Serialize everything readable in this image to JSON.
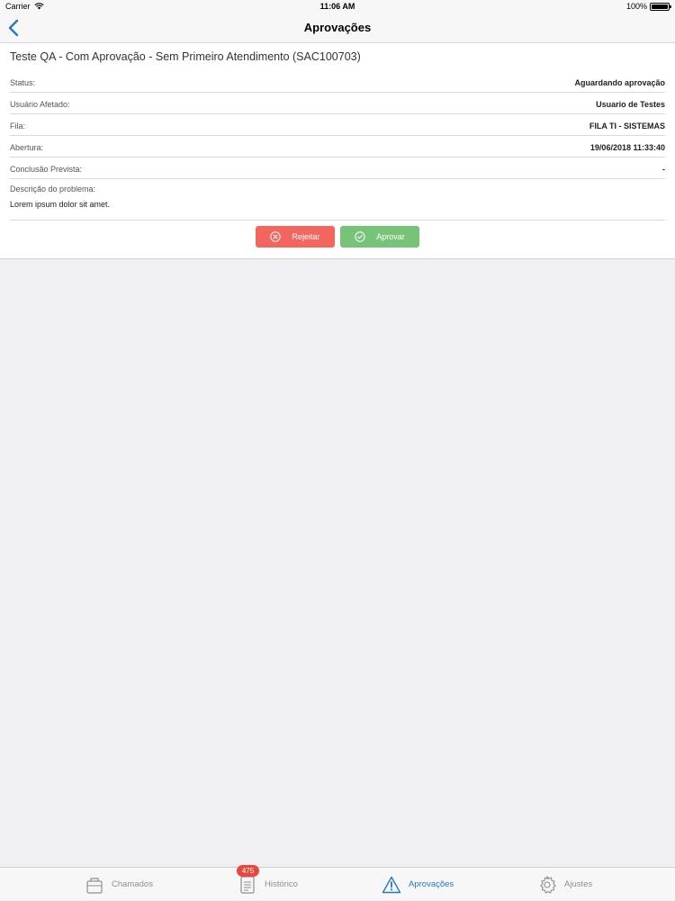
{
  "status_bar": {
    "carrier": "Carrier",
    "time": "11:06 AM",
    "battery": "100%",
    "battery_level": 1.0
  },
  "nav": {
    "title": "Aprovações",
    "back_icon": "chevron-left-icon"
  },
  "ticket": {
    "heading": "Teste QA - Com Aprovação - Sem Primeiro Atendimento (SAC100703)",
    "fields": [
      {
        "label": "Status:",
        "value": "Aguardando aprovação"
      },
      {
        "label": "Usuário Afetado:",
        "value": "Usuario de Testes"
      },
      {
        "label": "Fila:",
        "value": "FILA TI - SISTEMAS"
      },
      {
        "label": "Abertura:",
        "value": "19/06/2018 11:33:40"
      },
      {
        "label": "Conclusão Prevista:",
        "value": "-"
      }
    ],
    "description_label": "Descrição do problema:",
    "description": "Lorem ipsum dolor sit amet."
  },
  "actions": {
    "reject_label": "Rejeitar",
    "approve_label": "Aprovar",
    "reject_color": "#f2665f",
    "approve_color": "#77c478"
  },
  "tabs": [
    {
      "label": "Chamados",
      "icon": "briefcase-icon",
      "active": false
    },
    {
      "label": "Histórico",
      "icon": "document-icon",
      "badge": "475",
      "active": false
    },
    {
      "label": "Aprovações",
      "icon": "warning-icon",
      "active": true
    },
    {
      "label": "Ajustes",
      "icon": "gear-icon",
      "active": false
    }
  ],
  "colors": {
    "accent": "#2478c4",
    "badge": "#e8473d"
  }
}
